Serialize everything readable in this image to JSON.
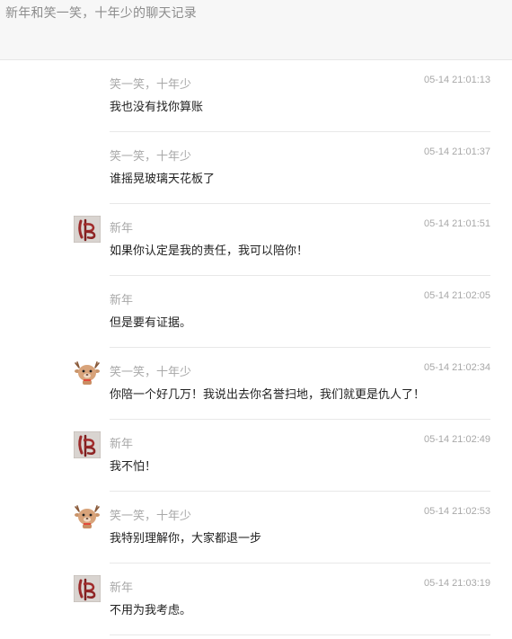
{
  "header": {
    "title": "新年和笑一笑，十年少的聊天记录"
  },
  "messages": [
    {
      "sender": "笑一笑，十年少",
      "time": "05-14 21:01:13",
      "text": "我也没有找你算账",
      "avatar": "none"
    },
    {
      "sender": "笑一笑，十年少",
      "time": "05-14 21:01:37",
      "text": "谁摇晃玻璃天花板了",
      "avatar": "none"
    },
    {
      "sender": "新年",
      "time": "05-14 21:01:51",
      "text": "如果你认定是我的责任，我可以陪你！",
      "avatar": "calligraphy-avatar"
    },
    {
      "sender": "新年",
      "time": "05-14 21:02:05",
      "text": "但是要有证据。",
      "avatar": "none"
    },
    {
      "sender": "笑一笑，十年少",
      "time": "05-14 21:02:34",
      "text": "你陪一个好几万！我说出去你名誉扫地，我们就更是仇人了！",
      "avatar": "cartoon-deer-avatar"
    },
    {
      "sender": "新年",
      "time": "05-14 21:02:49",
      "text": "我不怕！",
      "avatar": "calligraphy-avatar"
    },
    {
      "sender": "笑一笑，十年少",
      "time": "05-14 21:02:53",
      "text": "我特别理解你，大家都退一步",
      "avatar": "cartoon-deer-avatar"
    },
    {
      "sender": "新年",
      "time": "05-14 21:03:19",
      "text": "不用为我考虑。",
      "avatar": "calligraphy-avatar"
    }
  ]
}
